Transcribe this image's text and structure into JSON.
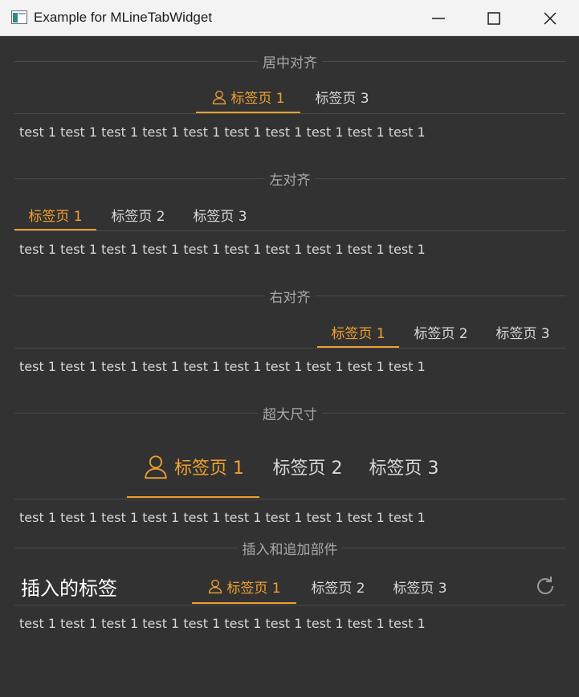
{
  "window": {
    "title": "Example for MLineTabWidget",
    "minimize_icon": "minimize-icon",
    "maximize_icon": "maximize-icon",
    "close_icon": "close-icon"
  },
  "colors": {
    "background": "#323232",
    "accent": "#f0a030",
    "text": "#d9d9d9",
    "divider": "#4a4a4a"
  },
  "sections": {
    "center": {
      "heading": "居中对齐",
      "tabs": [
        "标签页 1",
        "标签页 3"
      ],
      "active_icon": "user-icon",
      "body": "test 1 test 1 test 1 test 1 test 1 test 1 test 1 test 1 test 1 test 1"
    },
    "left": {
      "heading": "左对齐",
      "tabs": [
        "标签页 1",
        "标签页 2",
        "标签页 3"
      ],
      "body": "test 1 test 1 test 1 test 1 test 1 test 1 test 1 test 1 test 1 test 1"
    },
    "right": {
      "heading": "右对齐",
      "tabs": [
        "标签页 1",
        "标签页 2",
        "标签页 3"
      ],
      "body": "test 1 test 1 test 1 test 1 test 1 test 1 test 1 test 1 test 1 test 1"
    },
    "large": {
      "heading": "超大尺寸",
      "tabs": [
        "标签页 1",
        "标签页 2",
        "标签页 3"
      ],
      "active_icon": "user-icon",
      "body": "test 1 test 1 test 1 test 1 test 1 test 1 test 1 test 1 test 1 test 1"
    },
    "insert": {
      "heading": "插入和追加部件",
      "inserted_label": "插入的标签",
      "tabs": [
        "标签页 1",
        "标签页 2",
        "标签页 3"
      ],
      "active_icon": "user-icon",
      "append_icon": "refresh-icon",
      "body": "test 1 test 1 test 1 test 1 test 1 test 1 test 1 test 1 test 1 test 1"
    }
  }
}
